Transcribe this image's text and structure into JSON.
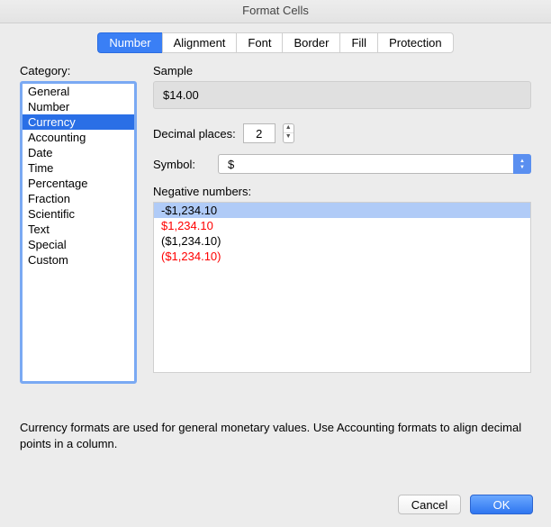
{
  "window": {
    "title": "Format Cells"
  },
  "tabs": {
    "number": "Number",
    "alignment": "Alignment",
    "font": "Font",
    "border": "Border",
    "fill": "Fill",
    "protection": "Protection"
  },
  "category": {
    "label": "Category:",
    "items": [
      "General",
      "Number",
      "Currency",
      "Accounting",
      "Date",
      "Time",
      "Percentage",
      "Fraction",
      "Scientific",
      "Text",
      "Special",
      "Custom"
    ],
    "selectedIndex": 2
  },
  "sample": {
    "label": "Sample",
    "value": "$14.00"
  },
  "decimal": {
    "label": "Decimal places:",
    "value": "2"
  },
  "symbol": {
    "label": "Symbol:",
    "value": "$"
  },
  "negative": {
    "label": "Negative numbers:",
    "items": [
      {
        "text": "-$1,234.10",
        "red": false
      },
      {
        "text": "$1,234.10",
        "red": true
      },
      {
        "text": "($1,234.10)",
        "red": false
      },
      {
        "text": "($1,234.10)",
        "red": true
      }
    ],
    "selectedIndex": 0
  },
  "description": "Currency formats are used for general monetary values.  Use Accounting formats to align decimal points in a column.",
  "buttons": {
    "cancel": "Cancel",
    "ok": "OK"
  }
}
